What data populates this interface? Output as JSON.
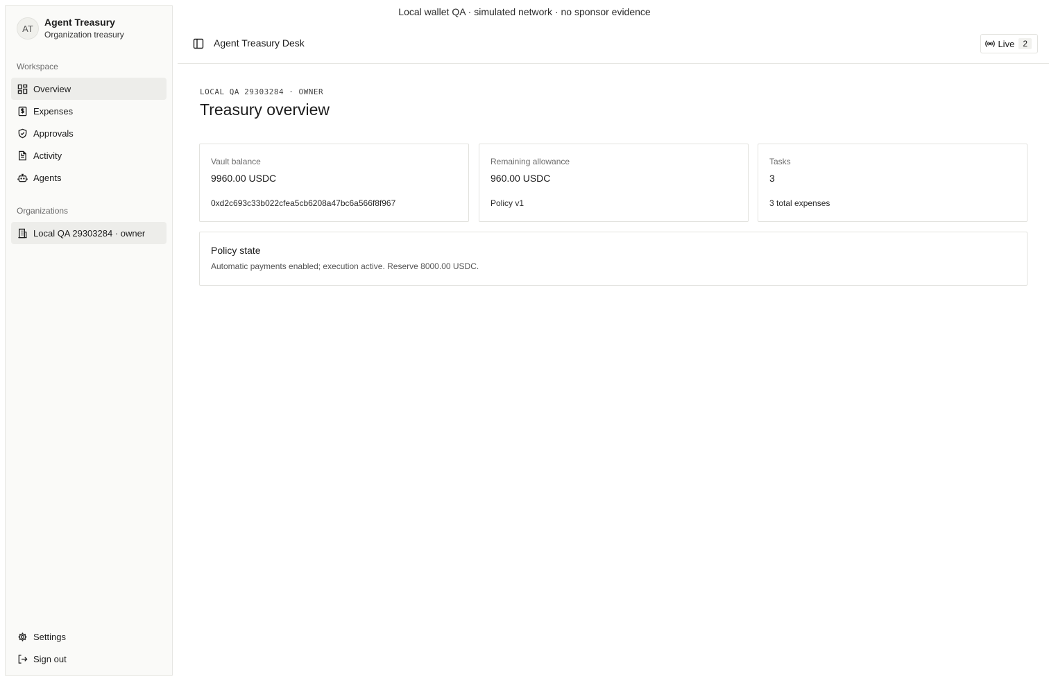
{
  "banner": "Local wallet QA · simulated network · no sponsor evidence",
  "brand": {
    "initials": "AT",
    "title": "Agent Treasury",
    "subtitle": "Organization treasury"
  },
  "sidebar": {
    "workspace_label": "Workspace",
    "items": [
      {
        "label": "Overview",
        "icon": "grid-icon",
        "active": true
      },
      {
        "label": "Expenses",
        "icon": "receipt-dollar-icon"
      },
      {
        "label": "Approvals",
        "icon": "shield-check-icon"
      },
      {
        "label": "Activity",
        "icon": "document-icon"
      },
      {
        "label": "Agents",
        "icon": "bot-icon"
      }
    ],
    "organizations_label": "Organizations",
    "organizations": [
      {
        "label": "Local QA 29303284 · owner",
        "icon": "building-icon",
        "active": true
      }
    ],
    "footer": [
      {
        "label": "Settings",
        "icon": "gear-icon"
      },
      {
        "label": "Sign out",
        "icon": "sign-out-icon"
      }
    ]
  },
  "header": {
    "title": "Agent Treasury Desk",
    "live_label": "Live",
    "live_count": "2"
  },
  "main": {
    "eyebrow": "LOCAL QA 29303284 · OWNER",
    "title": "Treasury overview",
    "cards": [
      {
        "label": "Vault balance",
        "value": "9960.00 USDC",
        "sub": "0xd2c693c33b022cfea5cb6208a47bc6a566f8f967"
      },
      {
        "label": "Remaining allowance",
        "value": "960.00 USDC",
        "sub": "Policy v1"
      },
      {
        "label": "Tasks",
        "value": "3",
        "sub": "3 total expenses"
      }
    ],
    "policy": {
      "title": "Policy state",
      "description": "Automatic payments enabled; execution active. Reserve 8000.00 USDC."
    }
  }
}
